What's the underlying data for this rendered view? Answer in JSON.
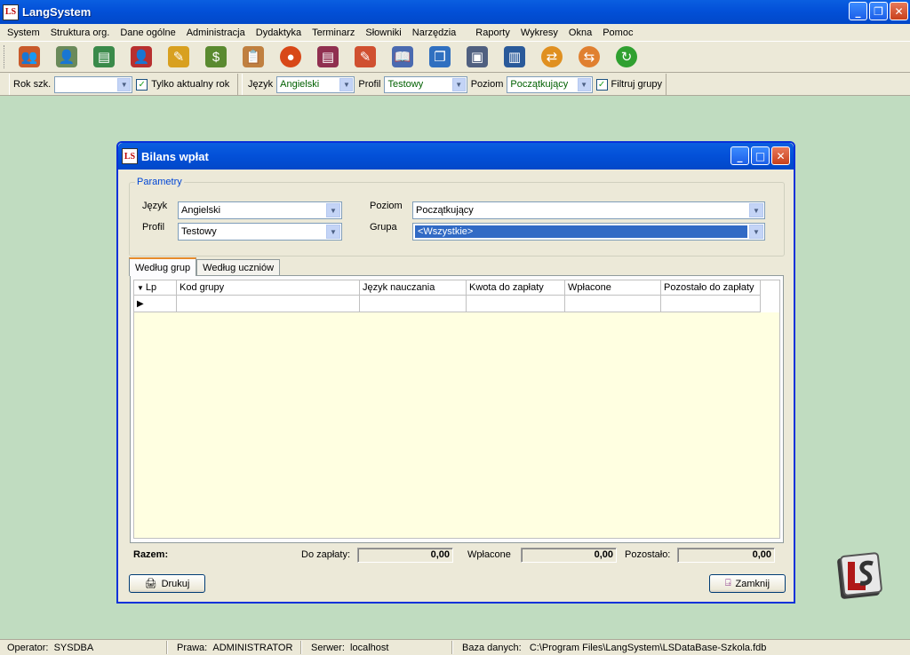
{
  "app": {
    "title": "LangSystem",
    "logo_text": "LS"
  },
  "menu": [
    "System",
    "Struktura org.",
    "Dane ogólne",
    "Administracja",
    "Dydaktyka",
    "Terminarz",
    "Słowniki",
    "Narzędzia",
    "Raporty",
    "Wykresy",
    "Okna",
    "Pomoc"
  ],
  "toolbar": {
    "icons": [
      "people-icon",
      "teacher-icon",
      "books-icon",
      "person-red-icon",
      "certificate-icon",
      "money-bag-icon",
      "clipboard-icon",
      "record-icon",
      "stack-books-icon",
      "notebook-icon",
      "open-book-icon",
      "copy-icon",
      "windows-icon",
      "columns-icon",
      "refresh-left-icon",
      "refresh-right-icon",
      "recycle-icon"
    ]
  },
  "filters": {
    "rok_label": "Rok szk.",
    "rok_value": "",
    "aktualny_label": "Tylko aktualny rok",
    "jezyk_label": "Język",
    "jezyk_value": "Angielski",
    "profil_label": "Profil",
    "profil_value": "Testowy",
    "poziom_label": "Poziom",
    "poziom_value": "Początkujący",
    "filtruj_label": "Filtruj grupy"
  },
  "dialog": {
    "title": "Bilans wpłat",
    "params_legend": "Parametry",
    "jezyk_label": "Język",
    "jezyk_value": "Angielski",
    "profil_label": "Profil",
    "profil_value": "Testowy",
    "poziom_label": "Poziom",
    "poziom_value": "Początkujący",
    "grupa_label": "Grupa",
    "grupa_value": "<Wszystkie>",
    "tabs": [
      "Według grup",
      "Według uczniów"
    ],
    "columns": [
      "Lp",
      "Kod grupy",
      "Język nauczania",
      "Kwota do zapłaty",
      "Wpłacone",
      "Pozostało do zapłaty"
    ],
    "rows": [
      [
        "",
        "",
        "",
        "",
        "",
        ""
      ]
    ],
    "totals": {
      "razem_label": "Razem:",
      "do_zaplaty_label": "Do zapłaty:",
      "do_zaplaty_value": "0,00",
      "wplacone_label": "Wpłacone",
      "wplacone_value": "0,00",
      "pozostalo_label": "Pozostało:",
      "pozostalo_value": "0,00"
    },
    "print_label": "Drukuj",
    "close_label": "Zamknij"
  },
  "status": {
    "operator_label": "Operator:",
    "operator_value": "SYSDBA",
    "prawa_label": "Prawa:",
    "prawa_value": "ADMINISTRATOR",
    "serwer_label": "Serwer:",
    "serwer_value": "localhost",
    "baza_label": "Baza danych:",
    "baza_value": "C:\\Program Files\\LangSystem\\LSDataBase-Szkola.fdb"
  },
  "colors": {
    "desktop": "#c0dcc0",
    "titlebar": "#0350d8",
    "grid_bg": "#ffffe1",
    "selection": "#316ac5",
    "combo_text": "#006000"
  }
}
